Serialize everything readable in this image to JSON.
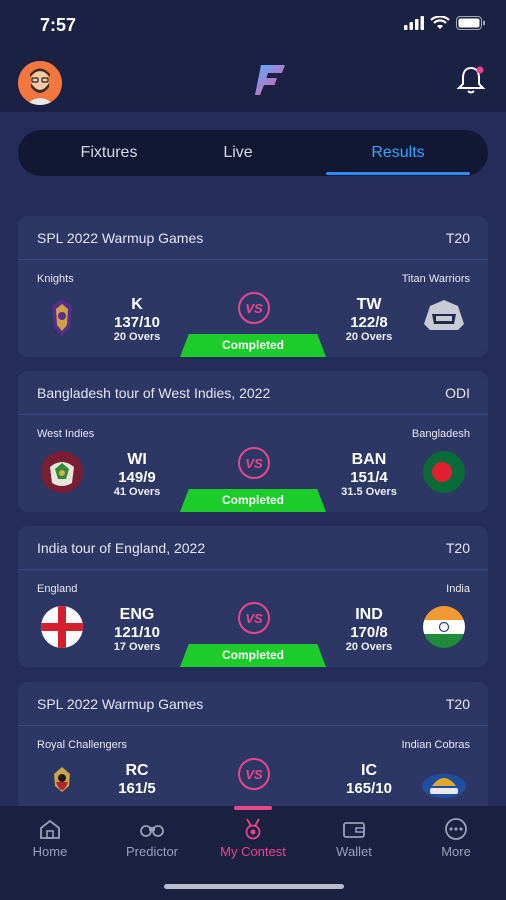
{
  "status": {
    "time": "7:57"
  },
  "tabs": [
    {
      "label": "Fixtures",
      "active": false
    },
    {
      "label": "Live",
      "active": false
    },
    {
      "label": "Results",
      "active": true
    }
  ],
  "matches": [
    {
      "title": "SPL 2022 Warmup Games",
      "format": "T20",
      "team1": {
        "name": "Knights",
        "abbr": "K",
        "score": "137/10",
        "overs": "20 Overs",
        "logo": "knights-logo"
      },
      "team2": {
        "name": "Titan Warriors",
        "abbr": "TW",
        "score": "122/8",
        "overs": "20 Overs",
        "logo": "titans-logo"
      },
      "status": "Completed"
    },
    {
      "title": "Bangladesh tour of West Indies, 2022",
      "format": "ODI",
      "team1": {
        "name": "West Indies",
        "abbr": "WI",
        "score": "149/9",
        "overs": "41 Overs",
        "logo": "west-indies-flag"
      },
      "team2": {
        "name": "Bangladesh",
        "abbr": "BAN",
        "score": "151/4",
        "overs": "31.5 Overs",
        "logo": "bangladesh-flag"
      },
      "status": "Completed"
    },
    {
      "title": "India tour of England, 2022",
      "format": "T20",
      "team1": {
        "name": "England",
        "abbr": "ENG",
        "score": "121/10",
        "overs": "17 Overs",
        "logo": "england-flag"
      },
      "team2": {
        "name": "India",
        "abbr": "IND",
        "score": "170/8",
        "overs": "20 Overs",
        "logo": "india-flag"
      },
      "status": "Completed"
    },
    {
      "title": "SPL 2022 Warmup Games",
      "format": "T20",
      "team1": {
        "name": "Royal Challengers",
        "abbr": "RC",
        "score": "161/5",
        "overs": "",
        "logo": "royal-challengers-logo"
      },
      "team2": {
        "name": "Indian Cobras",
        "abbr": "IC",
        "score": "165/10",
        "overs": "",
        "logo": "indian-cobras-logo"
      },
      "status": ""
    }
  ],
  "nav": [
    {
      "label": "Home",
      "icon": "home-icon",
      "active": false
    },
    {
      "label": "Predictor",
      "icon": "binoculars-icon",
      "active": false
    },
    {
      "label": "My Contest",
      "icon": "medal-icon",
      "active": true
    },
    {
      "label": "Wallet",
      "icon": "wallet-icon",
      "active": false
    },
    {
      "label": "More",
      "icon": "more-icon",
      "active": false
    }
  ],
  "colors": {
    "background": "#1b2140",
    "card": "#2d3766",
    "accent_blue": "#34a6ff",
    "completed_green": "#1ccc2a",
    "active_pink": "#e8478a"
  }
}
